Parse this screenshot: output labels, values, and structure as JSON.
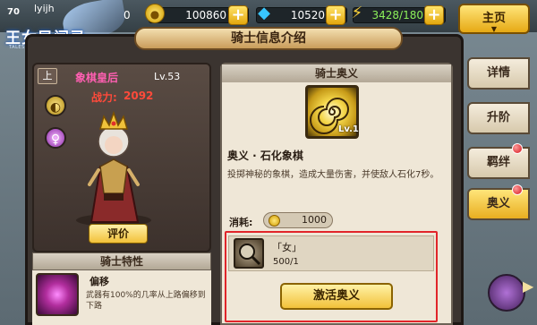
{
  "topbar": {
    "player_level": "70",
    "username": "lyijh",
    "logo_title": "王女异闻录",
    "logo_subtitle": "TALES OF PRINCESS",
    "notice_count": "0",
    "gold": "100860",
    "diamond": "10520",
    "energy": "3428/180",
    "menu_label": "主页"
  },
  "page": {
    "title": "骑士信息介绍"
  },
  "knight": {
    "rank": "上",
    "name": "象棋皇后",
    "level": "Lv.53",
    "power_label": "战力:",
    "power_value": "2092",
    "eval_label": "评价"
  },
  "trait": {
    "header": "骑士特性",
    "name": "偏移",
    "description": "武器有100%的几率从上路偏移到下路"
  },
  "secret": {
    "header": "骑士奥义",
    "skill_level": "Lv.1",
    "skill_name": "奥义 · 石化象棋",
    "skill_description": "投掷神秘的象棋，造成大量伤害，并使敌人石化7秒。",
    "cost_label": "消耗:",
    "cost_value": "1000",
    "material_name": "「女」",
    "material_count": "500/1",
    "activate_label": "激活奥义"
  },
  "side_tabs": [
    {
      "label": "详情",
      "active": false,
      "has_dot": false
    },
    {
      "label": "升阶",
      "active": false,
      "has_dot": false
    },
    {
      "label": "羁绊",
      "active": false,
      "has_dot": true
    },
    {
      "label": "奥义",
      "active": true,
      "has_dot": true
    }
  ],
  "colors": {
    "accent_gold": "#f2c13a",
    "name_pink": "#ff5fb2",
    "power_red": "#ff4a3a",
    "highlight_red": "#e1252a"
  }
}
